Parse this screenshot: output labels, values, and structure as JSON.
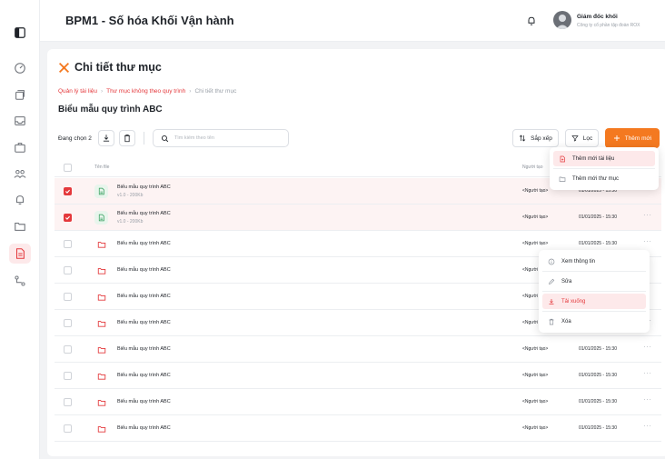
{
  "app": {
    "title": "BPM1 - Số hóa Khối Vận hành"
  },
  "user": {
    "name": "Giám đốc khối",
    "company": "Công ty cổ phần tập đoàn ROX"
  },
  "page": {
    "title": "Chi tiết thư mục",
    "subtitle": "Biểu mẫu quy trình ABC"
  },
  "breadcrumb": [
    "Quản lý tài liệu",
    "Thư mục không theo quy trình",
    "Chi tiết thư mục"
  ],
  "toolbar": {
    "selected_label": "Đang chọn 2",
    "search_placeholder": "Tìm kiếm theo tên",
    "sort_label": "Sắp xếp",
    "filter_label": "Lọc",
    "add_label": "Thêm mới"
  },
  "add_menu": [
    "Thêm mới tài liệu",
    "Thêm mới thư mục"
  ],
  "table": {
    "columns": [
      "Tên file",
      "Người tạo"
    ],
    "rows": [
      {
        "type": "doc",
        "checked": true,
        "name": "Biểu mẫu quy trình ABC",
        "meta": "v1.0 - 200Kb",
        "creator": "<Người tạo>",
        "date": "01/01/2025 - 15:30",
        "more": "···"
      },
      {
        "type": "doc",
        "checked": true,
        "name": "Biểu mẫu quy trình ABC",
        "meta": "v1.0 - 200Kb",
        "creator": "<Người tạo>",
        "date": "01/01/2025 - 15:30",
        "more": "···"
      },
      {
        "type": "folder",
        "checked": false,
        "name": "Biểu mẫu quy trình ABC",
        "meta": "",
        "creator": "<Người tạo>",
        "date": "01/01/2025 - 15:30",
        "more": "···"
      },
      {
        "type": "folder",
        "checked": false,
        "name": "Biểu mẫu quy trình ABC",
        "meta": "",
        "creator": "<Người",
        "date": "",
        "more": ""
      },
      {
        "type": "folder",
        "checked": false,
        "name": "Biểu mẫu quy trình ABC",
        "meta": "",
        "creator": "<Người",
        "date": "",
        "more": ""
      },
      {
        "type": "folder",
        "checked": false,
        "name": "Biểu mẫu quy trình ABC",
        "meta": "",
        "creator": "<Người tạo>",
        "date": "01/01/2025 - 15:30",
        "more": "···"
      },
      {
        "type": "folder",
        "checked": false,
        "name": "Biểu mẫu quy trình ABC",
        "meta": "",
        "creator": "<Người tạo>",
        "date": "01/01/2025 - 15:30",
        "more": "···"
      },
      {
        "type": "folder",
        "checked": false,
        "name": "Biểu mẫu quy trình ABC",
        "meta": "",
        "creator": "<Người tạo>",
        "date": "01/01/2025 - 15:30",
        "more": "···"
      },
      {
        "type": "folder",
        "checked": false,
        "name": "Biểu mẫu quy trình ABC",
        "meta": "",
        "creator": "<Người tạo>",
        "date": "01/01/2025 - 15:30",
        "more": "···"
      },
      {
        "type": "folder",
        "checked": false,
        "name": "Biểu mẫu quy trình ABC",
        "meta": "",
        "creator": "<Người tạo>",
        "date": "01/01/2025 - 15:30",
        "more": "···"
      }
    ]
  },
  "context_menu": [
    {
      "label": "Xem thông tin",
      "icon": "info-icon"
    },
    {
      "label": "Sửa",
      "icon": "edit-icon"
    },
    {
      "label": "Tải xuống",
      "icon": "download-icon"
    },
    {
      "label": "Xóa",
      "icon": "trash-icon"
    }
  ],
  "colors": {
    "accent_red": "#e4393c",
    "accent_orange": "#f47920",
    "selected_row": "#fdf3f3"
  }
}
